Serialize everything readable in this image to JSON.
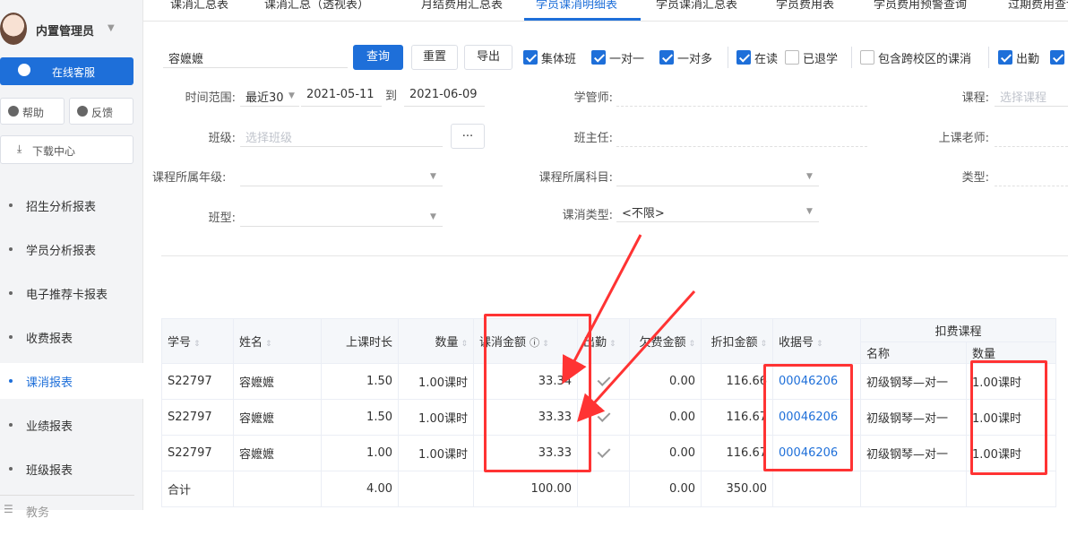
{
  "user": {
    "name": "内置管理员"
  },
  "sidebar": {
    "service_label": "在线客服",
    "help_label": "帮助",
    "feedback_label": "反馈",
    "download_label": "下载中心",
    "menu": [
      {
        "label": "招生分析报表"
      },
      {
        "label": "学员分析报表"
      },
      {
        "label": "电子推荐卡报表"
      },
      {
        "label": "收费报表"
      },
      {
        "label": "课消报表"
      },
      {
        "label": "业绩报表"
      },
      {
        "label": "班级报表"
      },
      {
        "label": "教务"
      }
    ]
  },
  "tabs": [
    {
      "label": "课消汇总表"
    },
    {
      "label": "课消汇总（透视表）"
    },
    {
      "label": "月结费用汇总表"
    },
    {
      "label": "学员课消明细表"
    },
    {
      "label": "学员课消汇总表"
    },
    {
      "label": "学员费用表"
    },
    {
      "label": "学员费用预警查询"
    },
    {
      "label": "过期费用查询"
    }
  ],
  "filters": {
    "student_name": "容嬷嬷",
    "query_label": "查询",
    "reset_label": "重置",
    "export_label": "导出",
    "checkboxes": [
      {
        "label": "集体班",
        "checked": true
      },
      {
        "label": "一对一",
        "checked": true
      },
      {
        "label": "一对多",
        "checked": true
      },
      {
        "label": "在读",
        "checked": true
      },
      {
        "label": "已退学",
        "checked": false
      },
      {
        "label": "包含跨校区的课消",
        "checked": false
      },
      {
        "label": "出勤",
        "checked": true
      }
    ],
    "time_range_label": "时间范围:",
    "time_range_value": "最近30",
    "date_from": "2021-05-11",
    "date_to_label": "到",
    "date_to": "2021-06-09",
    "manager_label": "学管师:",
    "course_label": "课程:",
    "course_placeholder": "选择课程",
    "class_label": "班级:",
    "class_placeholder": "选择班级",
    "ellipsis_label": "...",
    "head_teacher_label": "班主任:",
    "teacher_label": "上课老师:",
    "grade_label": "课程所属年级:",
    "subject_label": "课程所属科目:",
    "type_label": "类型:",
    "class_type_label": "班型:",
    "consume_type_label": "课消类型:",
    "consume_type_value": "<不限>"
  },
  "table": {
    "group_header": "扣费课程",
    "headers": [
      "学号",
      "姓名",
      "上课时长",
      "数量",
      "课消金额",
      "出勤",
      "欠费金额",
      "折扣金额",
      "收据号",
      "名称",
      "数量"
    ],
    "rows": [
      {
        "id": "S22797",
        "name": "容嬷嬷",
        "hours": "1.50",
        "qty": "1.00课时",
        "amount": "33.34",
        "owed": "0.00",
        "discount": "116.66",
        "receipt": "00046206",
        "course": "初级钢琴—对一",
        "course_qty": "1.00课时"
      },
      {
        "id": "S22797",
        "name": "容嬷嬷",
        "hours": "1.50",
        "qty": "1.00课时",
        "amount": "33.33",
        "owed": "0.00",
        "discount": "116.67",
        "receipt": "00046206",
        "course": "初级钢琴—对一",
        "course_qty": "1.00课时"
      },
      {
        "id": "S22797",
        "name": "容嬷嬷",
        "hours": "1.00",
        "qty": "1.00课时",
        "amount": "33.33",
        "owed": "0.00",
        "discount": "116.67",
        "receipt": "00046206",
        "course": "初级钢琴—对一",
        "course_qty": "1.00课时"
      }
    ],
    "total": {
      "label": "合计",
      "hours": "4.00",
      "amount": "100.00",
      "owed": "0.00",
      "discount": "350.00"
    }
  },
  "colors": {
    "accent": "#1e6fd9",
    "annotation": "#ff3333"
  }
}
